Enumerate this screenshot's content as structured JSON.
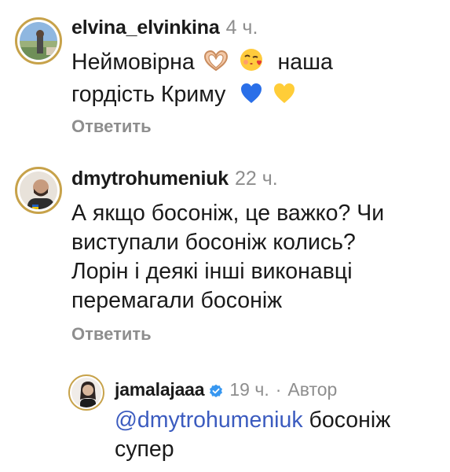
{
  "comments": [
    {
      "username": "elvina_elvinkina",
      "time": "4 ч.",
      "text_line1": "Неймовірна",
      "text_line1_tail": "наша",
      "text_line2": "гордість Криму",
      "reply_label": "Ответить",
      "emojis": [
        "heart-hands-emoji",
        "face-blowing-kiss-emoji",
        "blue-heart-emoji",
        "yellow-heart-emoji"
      ]
    },
    {
      "username": "dmytrohumeniuk",
      "time": "22 ч.",
      "lines": [
        "А якщо босоніж, це важко? Чи",
        "виступали босоніж колись?",
        "Лорін і деякі інші виконавці",
        "перемагали босоніж"
      ],
      "reply_label": "Ответить"
    }
  ],
  "reply": {
    "username": "jamalajaaa",
    "time": "19 ч.",
    "separator": "·",
    "author_label": "Автор",
    "mention": "@dmytrohumeniuk",
    "text_line1_tail": "босоніж",
    "text_line2": "супер",
    "verified": true
  },
  "colors": {
    "mention": "#3b5bbf",
    "muted": "#8e8e8e",
    "verified_badge": "#3797f0"
  }
}
